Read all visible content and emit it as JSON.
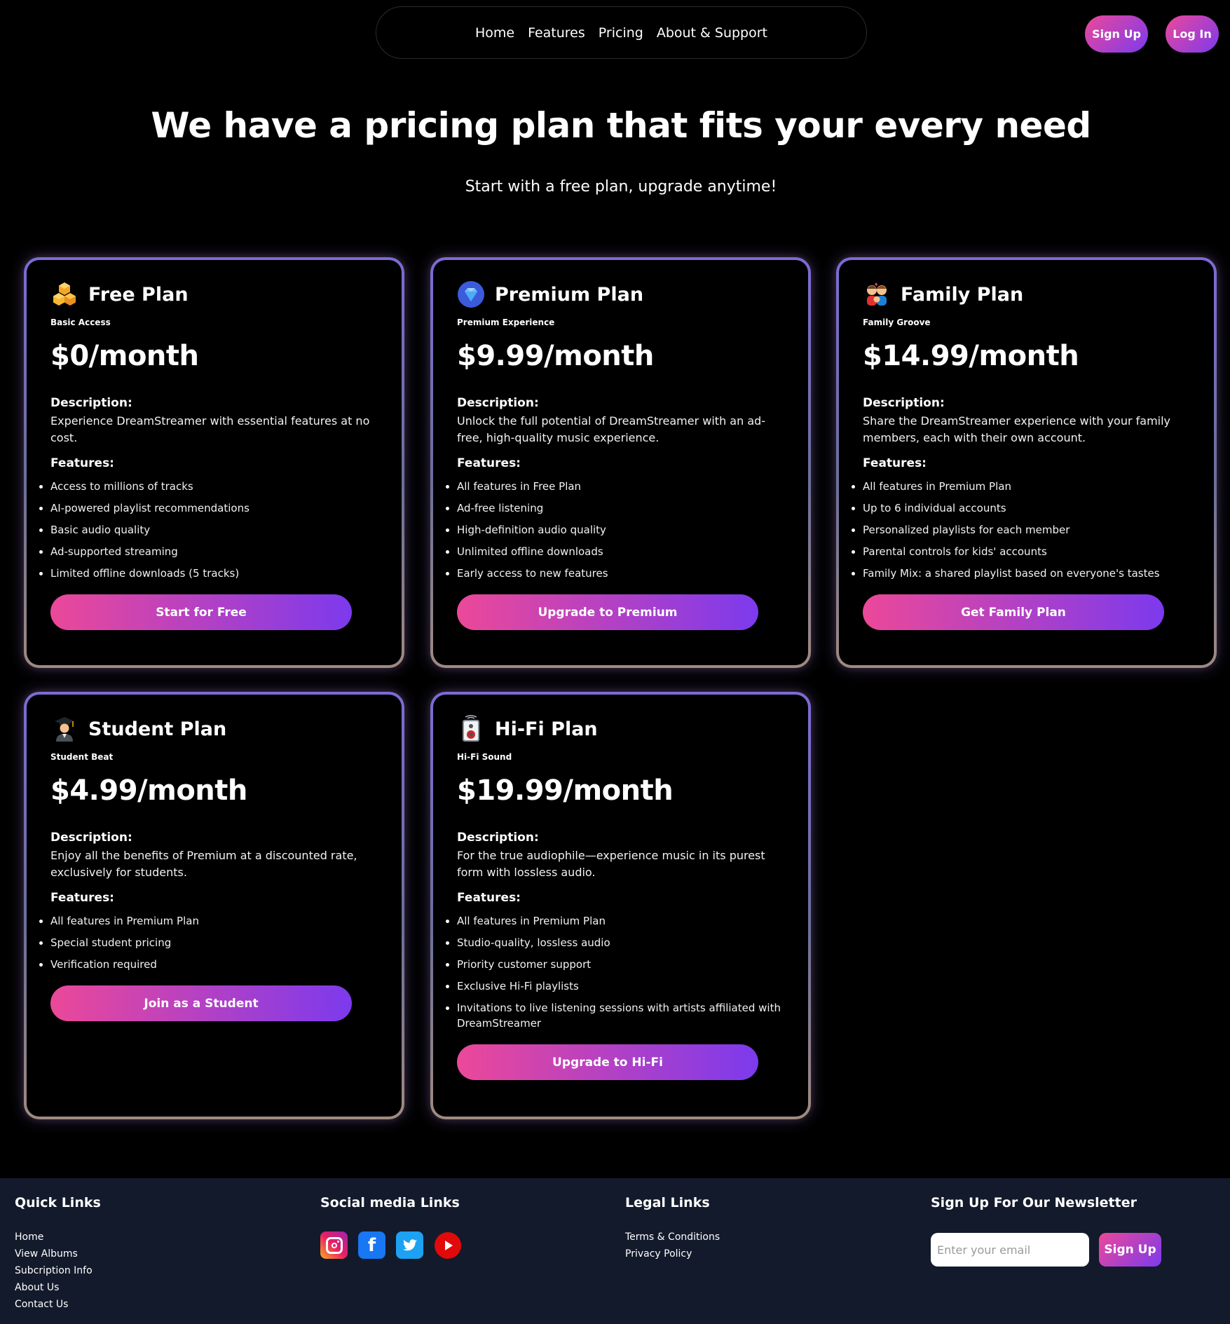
{
  "nav": {
    "links": [
      "Home",
      "Features",
      "Pricing",
      "About & Support"
    ],
    "signup_label": "Sign Up",
    "login_label": "Log In"
  },
  "hero": {
    "title": "We have a pricing plan that fits your every need",
    "subtitle": "Start with a free plan, upgrade anytime!"
  },
  "labels": {
    "description": "Description:",
    "features": "Features:"
  },
  "plans": [
    {
      "icon": "cubes-icon",
      "name": "Free Plan",
      "tag": "Basic Access",
      "price": "$0/month",
      "description": "Experience DreamStreamer with essential features at no cost.",
      "features": [
        "Access to millions of tracks",
        "AI-powered playlist recommendations",
        "Basic audio quality",
        "Ad-supported streaming",
        "Limited offline downloads (5 tracks)"
      ],
      "cta": "Start for Free"
    },
    {
      "icon": "gem-icon",
      "name": "Premium Plan",
      "tag": "Premium Experience",
      "price": "$9.99/month",
      "description": "Unlock the full potential of DreamStreamer with an ad-free, high-quality music experience.",
      "features": [
        "All features in Free Plan",
        "Ad-free listening",
        "High-definition audio quality",
        "Unlimited offline downloads",
        "Early access to new features"
      ],
      "cta": "Upgrade to Premium"
    },
    {
      "icon": "family-icon",
      "name": "Family Plan",
      "tag": "Family Groove",
      "price": "$14.99/month",
      "description": "Share the DreamStreamer experience with your family members, each with their own account.",
      "features": [
        "All features in Premium Plan",
        "Up to 6 individual accounts",
        "Personalized playlists for each member",
        "Parental controls for kids' accounts",
        "Family Mix: a shared playlist based on everyone's tastes"
      ],
      "cta": "Get Family Plan"
    },
    {
      "icon": "student-icon",
      "name": "Student Plan",
      "tag": "Student Beat",
      "price": "$4.99/month",
      "description": "Enjoy all the benefits of Premium at a discounted rate, exclusively for students.",
      "features": [
        "All features in Premium Plan",
        "Special student pricing",
        "Verification required"
      ],
      "cta": "Join as a Student"
    },
    {
      "icon": "speaker-icon",
      "name": "Hi-Fi Plan",
      "tag": "Hi-Fi Sound",
      "price": "$19.99/month",
      "description": "For the true audiophile—experience music in its purest form with lossless audio.",
      "features": [
        "All features in Premium Plan",
        "Studio-quality, lossless audio",
        "Priority customer support",
        "Exclusive Hi-Fi playlists",
        "Invitations to live listening sessions with artists affiliated with DreamStreamer"
      ],
      "cta": "Upgrade to Hi-Fi"
    }
  ],
  "footer": {
    "quick_links_title": "Quick Links",
    "quick_links": [
      "Home",
      "View Albums",
      "Subcription Info",
      "About Us",
      "Contact Us"
    ],
    "social_title": "Social media Links",
    "social": [
      "instagram-icon",
      "facebook-icon",
      "twitter-icon",
      "youtube-icon"
    ],
    "legal_title": "Legal Links",
    "legal_links": [
      "Terms & Conditions",
      "Privacy Policy"
    ],
    "newsletter_title": "Sign Up For Our Newsletter",
    "newsletter_placeholder": "Enter your email",
    "newsletter_button": "Sign Up"
  },
  "colors": {
    "accent_start": "#ec4899",
    "accent_end": "#7c3aed",
    "footer_bg": "#131a2b"
  }
}
